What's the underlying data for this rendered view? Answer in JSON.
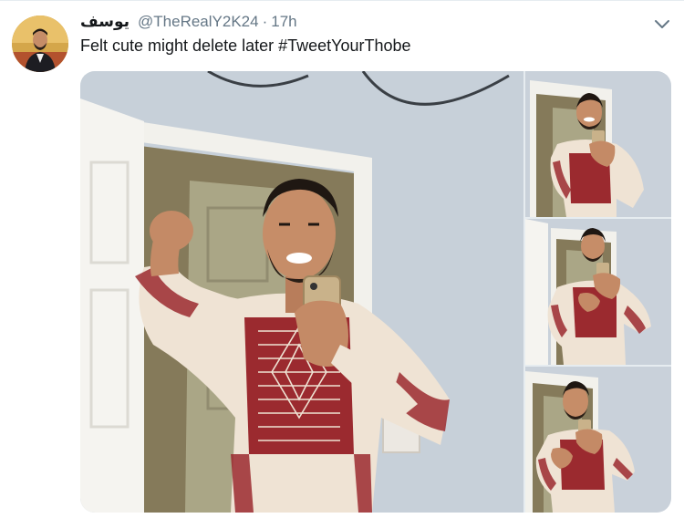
{
  "tweet": {
    "display_name": "يوسف",
    "handle": "@TheRealY2K24",
    "separator": "·",
    "time": "17h",
    "text_plain": "Felt cute might delete later ",
    "hashtag": "#TweetYourThobe"
  },
  "icons": {
    "more": "chevron-down-icon"
  },
  "colors": {
    "text": "#14171a",
    "muted": "#657786",
    "thobe_embroidery": "#8b1d24",
    "thobe_fabric": "#efe3d4",
    "wall": "#c9d1da"
  }
}
